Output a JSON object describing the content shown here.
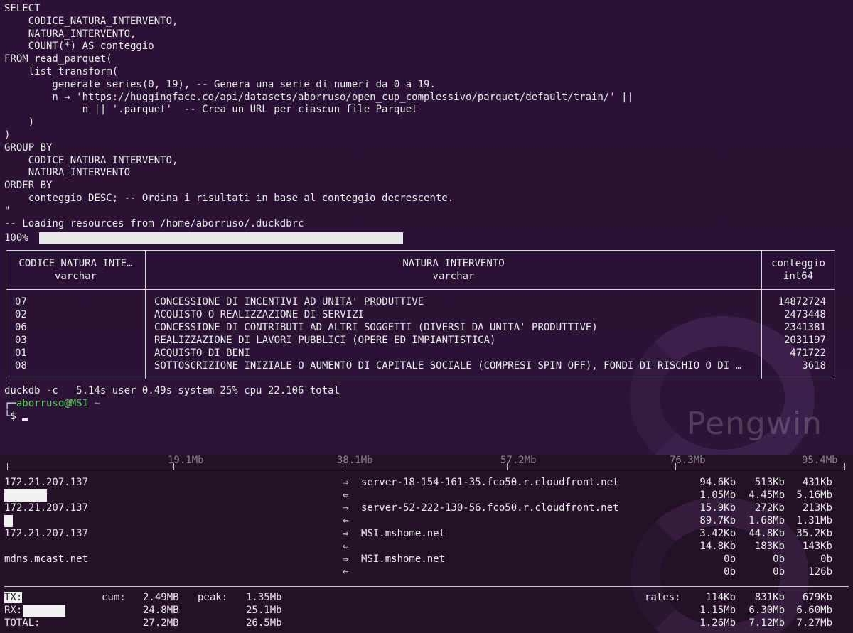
{
  "sql": [
    "SELECT",
    "    CODICE_NATURA_INTERVENTO,",
    "    NATURA_INTERVENTO,",
    "    COUNT(*) AS conteggio",
    "FROM read_parquet(",
    "    list_transform(",
    "        generate_series(0, 19), -- Genera una serie di numeri da 0 a 19.",
    "        n → 'https://huggingface.co/api/datasets/aborruso/open_cup_complessivo/parquet/default/train/' ||",
    "             n || '.parquet'  -- Crea un URL per ciascun file Parquet",
    "    )",
    ")",
    "GROUP BY",
    "    CODICE_NATURA_INTERVENTO,",
    "    NATURA_INTERVENTO",
    "ORDER BY",
    "    conteggio DESC; -- Ordina i risultati in base al conteggio decrescente.",
    "\"",
    "-- Loading resources from /home/aborruso/.duckdbrc"
  ],
  "progress": {
    "label": "100%",
    "fraction": 1.0
  },
  "table": {
    "headers": [
      {
        "name": "CODICE_NATURA_INTE…",
        "type": "varchar"
      },
      {
        "name": "NATURA_INTERVENTO",
        "type": "varchar"
      },
      {
        "name": "conteggio",
        "type": "int64"
      }
    ],
    "rows": [
      {
        "code": "07",
        "natura": "CONCESSIONE DI INCENTIVI AD UNITA' PRODUTTIVE",
        "count": "14872724"
      },
      {
        "code": "02",
        "natura": "ACQUISTO O REALIZZAZIONE DI SERVIZI",
        "count": "2473448"
      },
      {
        "code": "06",
        "natura": "CONCESSIONE DI CONTRIBUTI AD ALTRI SOGGETTI (DIVERSI DA UNITA' PRODUTTIVE)",
        "count": "2341381"
      },
      {
        "code": "03",
        "natura": "REALIZZAZIONE DI LAVORI PUBBLICI (OPERE ED IMPIANTISTICA)",
        "count": "2031197"
      },
      {
        "code": "01",
        "natura": "ACQUISTO DI BENI",
        "count": "471722"
      },
      {
        "code": "08",
        "natura": "SOTTOSCRIZIONE INIZIALE O AUMENTO DI CAPITALE SOCIALE (COMPRESI SPIN OFF), FONDI DI RISCHIO O DI …",
        "count": "3618"
      }
    ]
  },
  "timing": "duckdb -c   5.14s user 0.49s system 25% cpu 22.106 total",
  "prompt": {
    "user_host": "aborruso@MSI",
    "dir": "~",
    "symbol": "$"
  },
  "watermark": "Pengwin",
  "iftop": {
    "scale": [
      "19.1Mb",
      "38.1Mb",
      "57.2Mb",
      "76.3Mb",
      "95.4Mb"
    ],
    "connections": [
      {
        "src": "172.21.207.137",
        "dst": "server-18-154-161-35.fco50.r.cloudfront.net",
        "out": [
          "94.6Kb",
          "513Kb",
          "431Kb"
        ],
        "in": [
          "1.05Mb",
          "4.45Mb",
          "5.16Mb"
        ]
      },
      {
        "src": "172.21.207.137",
        "dst": "server-52-222-130-56.fco50.r.cloudfront.net",
        "out": [
          "15.9Kb",
          "272Kb",
          "213Kb"
        ],
        "in": [
          "89.7Kb",
          "1.68Mb",
          "1.31Mb"
        ]
      },
      {
        "src": "172.21.207.137",
        "dst": "MSI.mshome.net",
        "out": [
          "3.42Kb",
          "44.8Kb",
          "35.2Kb"
        ],
        "in": [
          "14.8Kb",
          "183Kb",
          "143Kb"
        ]
      },
      {
        "src": "mdns.mcast.net",
        "dst": "MSI.mshome.net",
        "out": [
          "0b",
          "0b",
          "0b"
        ],
        "in": [
          "0b",
          "0b",
          "126b"
        ]
      }
    ],
    "arrow_out": "⇒",
    "arrow_in": "⇐",
    "totals": {
      "cum_label": "cum:",
      "peak_label": "peak:",
      "rates_label": "rates:",
      "tx": {
        "label": "TX:",
        "cum": "2.49MB",
        "peak": "1.35Mb",
        "rates": [
          "114Kb",
          "831Kb",
          "679Kb"
        ]
      },
      "rx": {
        "label": "RX:",
        "cum": "24.8MB",
        "peak": "25.1Mb",
        "rates": [
          "1.15Mb",
          "6.30Mb",
          "6.60Mb"
        ]
      },
      "total": {
        "label": "TOTAL:",
        "cum": "27.2MB",
        "peak": "26.5Mb",
        "rates": [
          "1.26Mb",
          "7.12Mb",
          "7.27Mb"
        ]
      }
    }
  }
}
